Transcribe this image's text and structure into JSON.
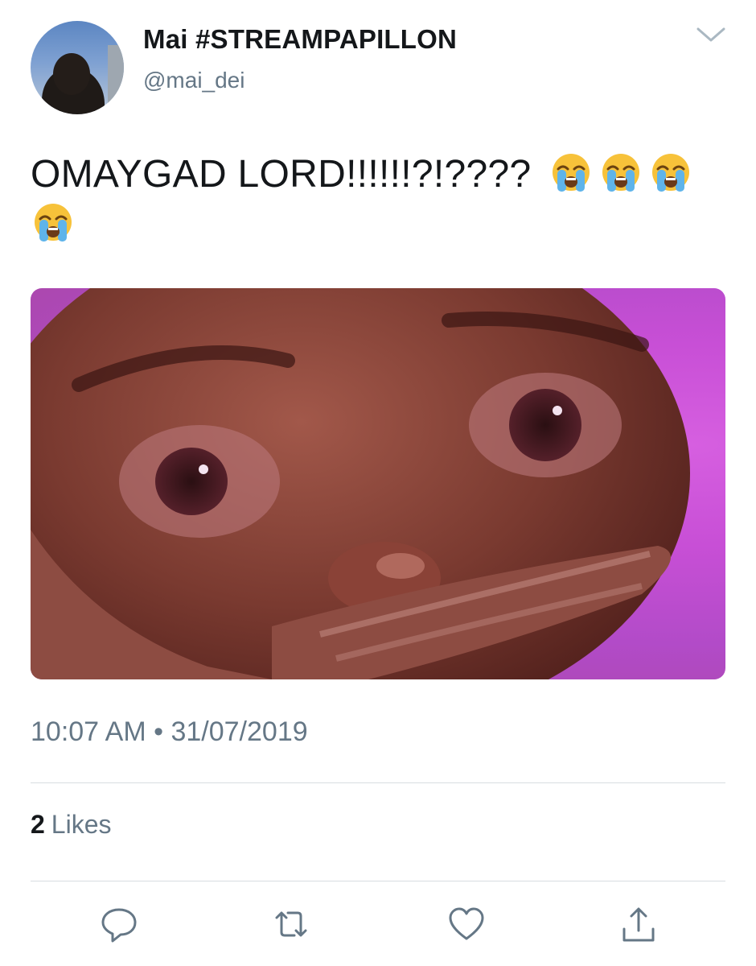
{
  "tweet": {
    "display_name": "Mai #STREAMPAPILLON",
    "handle": "@mai_dei",
    "text": "OMAYGAD LORD!!!!!!?!????",
    "emojis": [
      "loudly-crying-face",
      "loudly-crying-face",
      "loudly-crying-face",
      "loudly-crying-face"
    ],
    "time": "10:07 AM",
    "separator": "•",
    "date": "31/07/2019",
    "likes_count": "2",
    "likes_label": "Likes"
  },
  "icons": {
    "menu": "chevron-down-icon",
    "reply": "reply-icon",
    "retweet": "retweet-icon",
    "like": "heart-icon",
    "share": "share-icon"
  },
  "colors": {
    "primary_text": "#14171a",
    "secondary_text": "#657786",
    "divider": "#d8dde1",
    "media_background": "#c84fd6"
  }
}
